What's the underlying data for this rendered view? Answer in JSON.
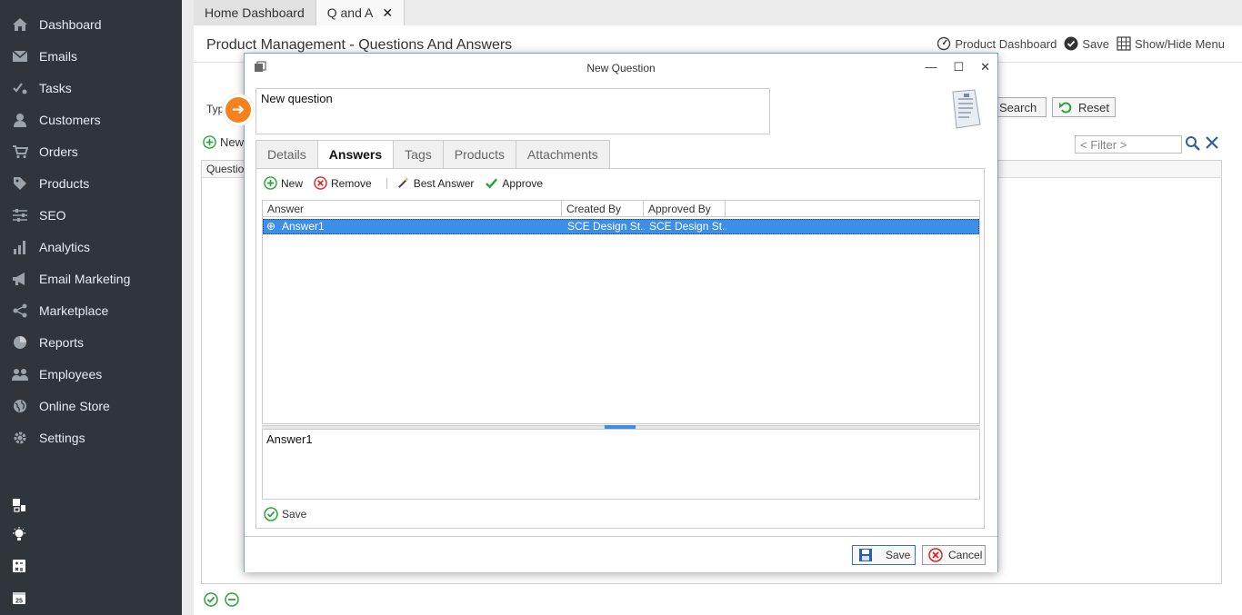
{
  "sidebar": {
    "items": [
      {
        "label": "Dashboard",
        "icon": "home-icon"
      },
      {
        "label": "Emails",
        "icon": "envelope-icon"
      },
      {
        "label": "Tasks",
        "icon": "tasks-icon"
      },
      {
        "label": "Customers",
        "icon": "user-icon"
      },
      {
        "label": "Orders",
        "icon": "cart-icon"
      },
      {
        "label": "Products",
        "icon": "tag-icon"
      },
      {
        "label": "SEO",
        "icon": "sliders-icon"
      },
      {
        "label": "Analytics",
        "icon": "bar-chart-icon"
      },
      {
        "label": "Email Marketing",
        "icon": "megaphone-icon"
      },
      {
        "label": "Marketplace",
        "icon": "share-icon"
      },
      {
        "label": "Reports",
        "icon": "pie-chart-icon"
      },
      {
        "label": "Employees",
        "icon": "users-icon"
      },
      {
        "label": "Online Store",
        "icon": "globe-icon"
      },
      {
        "label": "Settings",
        "icon": "gear-icon"
      }
    ],
    "tools": [
      "windows-icon",
      "lightbulb-icon",
      "calculator-icon",
      "calendar-icon"
    ],
    "calendar_day": "25"
  },
  "tabs": [
    {
      "label": "Home Dashboard"
    },
    {
      "label": "Q and A",
      "active": true
    }
  ],
  "page": {
    "title": "Product Management - Questions And Answers",
    "actions": {
      "product_dashboard": "Product Dashboard",
      "save": "Save",
      "show_hide_menu": "Show/Hide Menu"
    },
    "type_label": "Typ",
    "search": "Search",
    "reset": "Reset",
    "new": "New",
    "filter_placeholder": "< Filter >",
    "grid_header": "Question"
  },
  "modal": {
    "title": "New Question",
    "question_text": "New question",
    "tabs": [
      "Details",
      "Answers",
      "Tags",
      "Products",
      "Attachments"
    ],
    "active_tab": "Answers",
    "toolbar": {
      "new": "New",
      "remove": "Remove",
      "best_answer": "Best Answer",
      "approve": "Approve"
    },
    "columns": [
      "Answer",
      "Created By",
      "Approved By"
    ],
    "rows": [
      {
        "answer": "Answer1",
        "created_by": "SCE Design St...",
        "approved_by": "SCE Design St..."
      }
    ],
    "answer_detail": "Answer1",
    "panel_save": "Save",
    "footer": {
      "save": "Save",
      "cancel": "Cancel"
    }
  },
  "colors": {
    "sidebar_bg": "#2f353b",
    "accent_blue": "#3d8ee6",
    "orange": "#f5821f",
    "green": "#2aa43a",
    "red": "#d9252a"
  }
}
